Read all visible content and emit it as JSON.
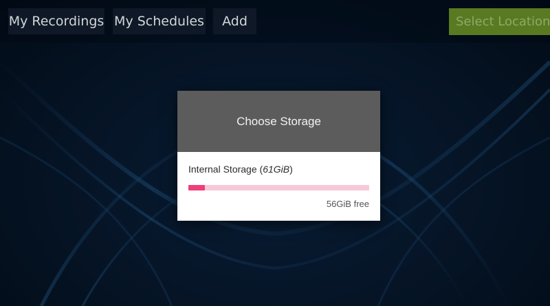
{
  "topbar": {
    "tabs": [
      {
        "label": "My Recordings"
      },
      {
        "label": "My Schedules"
      },
      {
        "label": "Add"
      }
    ],
    "select_location_label": "Select Location"
  },
  "dialog": {
    "title": "Choose Storage",
    "storage": {
      "name": "Internal Storage",
      "size_open": "(",
      "size": "61GiB",
      "size_close": ")",
      "free": "56GiB free",
      "used_fraction": 0.09
    }
  },
  "colors": {
    "background": "#06101c",
    "accent_green": "#5a7a22",
    "dialog_header": "#5b5c5b",
    "usage_fill": "#ef3f7a",
    "usage_track": "#f7c9d8"
  }
}
